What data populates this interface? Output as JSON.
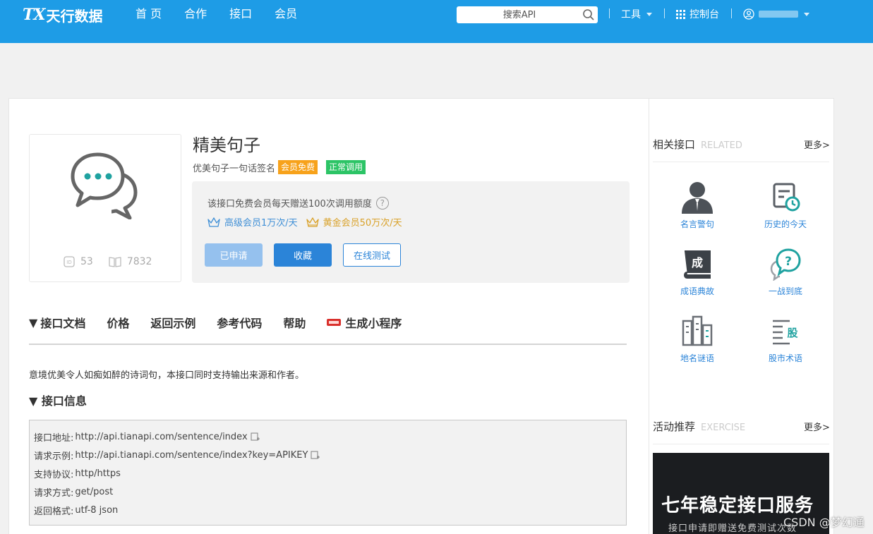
{
  "header": {
    "logo_mark": "TX",
    "logo_text": "天行数据",
    "nav": [
      {
        "label": "首 页"
      },
      {
        "label": "合作"
      },
      {
        "label": "接口"
      },
      {
        "label": "会员"
      }
    ],
    "search_placeholder": "搜索API",
    "tools_label": "工具",
    "console_label": "控制台",
    "bg_color": "#1e9ce6"
  },
  "api": {
    "title": "精美句子",
    "subtitle": "优美句子一句话签名",
    "badge_member": "会员免费",
    "badge_status": "正常调用",
    "id": "53",
    "views": "7832",
    "quota_text": "该接口免费会员每天赠送100次调用额度",
    "tier_advanced": "高级会员1万次/天",
    "tier_gold": "黄金会员50万次/天",
    "btn_applied": "已申请",
    "btn_collect": "收藏",
    "btn_test": "在线测试"
  },
  "tabs": [
    {
      "label": "接口文档",
      "active": true
    },
    {
      "label": "价格"
    },
    {
      "label": "返回示例"
    },
    {
      "label": "参考代码"
    },
    {
      "label": "帮助"
    },
    {
      "label": "生成小程序"
    }
  ],
  "tri_symbol": "▼",
  "doc": {
    "description": "意境优美令人如痴如醉的诗词句，本接口同时支持输出来源和作者。",
    "section_title": "接口信息",
    "rows": [
      {
        "label": "接口地址:",
        "value": "http://api.tianapi.com/sentence/index"
      },
      {
        "label": "请求示例:",
        "value": "http://api.tianapi.com/sentence/index?key=APIKEY"
      },
      {
        "label": "支持协议:",
        "value": "http/https"
      },
      {
        "label": "请求方式:",
        "value": "get/post"
      },
      {
        "label": "返回格式:",
        "value": "utf-8 json"
      }
    ]
  },
  "sidebar": {
    "related_title": "相关接口",
    "related_en": "RELATED",
    "more": "更多>",
    "related": [
      {
        "label": "名言警句",
        "icon": "person-icon"
      },
      {
        "label": "历史的今天",
        "icon": "calendar-clock-icon"
      },
      {
        "label": "成语典故",
        "icon": "idiom-book-icon"
      },
      {
        "label": "一战到底",
        "icon": "question-bubble-icon"
      },
      {
        "label": "地名谜语",
        "icon": "buildings-icon"
      },
      {
        "label": "股市术语",
        "icon": "stock-list-icon"
      }
    ],
    "activity_title": "活动推荐",
    "activity_en": "EXERCISE",
    "promo_line1": "七年稳定接口服务",
    "promo_line2": "接口申请即赠送免费测试次数"
  },
  "watermark": "CSDN @梦幻通灵"
}
